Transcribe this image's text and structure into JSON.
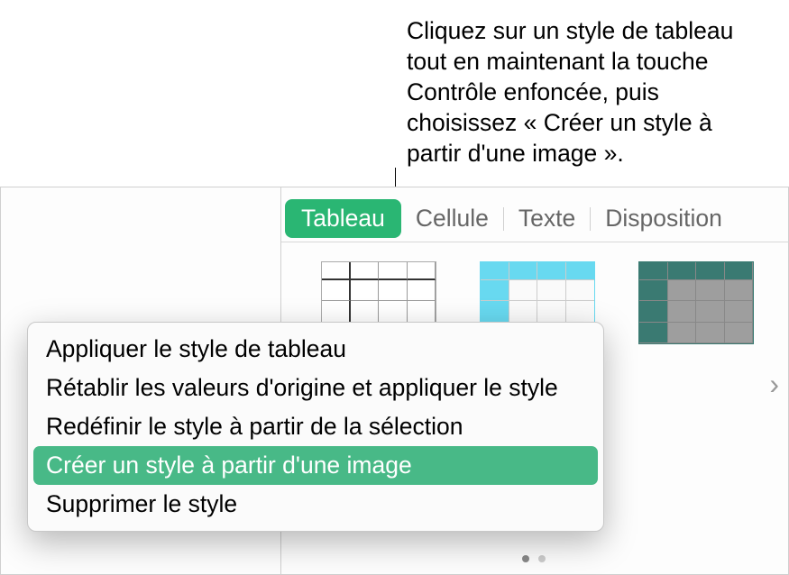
{
  "callout": {
    "text": "Cliquez sur un style de tableau tout en maintenant la touche Contrôle enfoncée, puis choisissez « Créer un style à partir d'une image »."
  },
  "tabs": {
    "items": [
      "Tableau",
      "Cellule",
      "Texte",
      "Disposition"
    ],
    "active_index": 0
  },
  "context_menu": {
    "items": [
      "Appliquer le style de tableau",
      "Rétablir les valeurs d'origine et appliquer le style",
      "Redéfinir le style à partir de la sélection",
      "Créer un style à partir d'une image",
      "Supprimer le style"
    ],
    "highlighted_index": 3
  },
  "style_thumbs": {
    "variants": [
      "white",
      "cyan",
      "teal",
      "outline"
    ]
  },
  "pager": {
    "count": 2,
    "active": 0
  },
  "colors": {
    "accent": "#2ab673",
    "menu_highlight": "#48b987"
  },
  "icons": {
    "chevron_right": "›"
  }
}
